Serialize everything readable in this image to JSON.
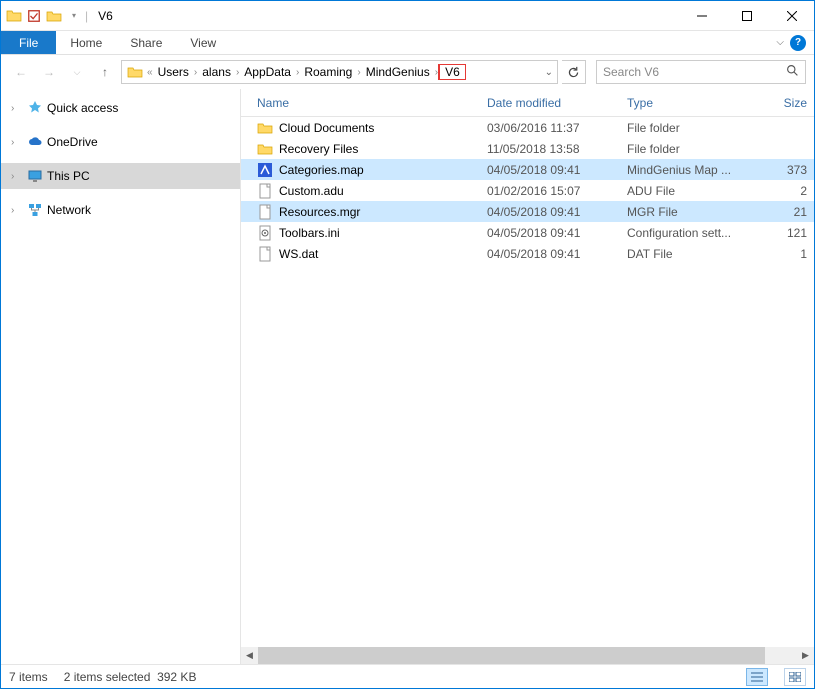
{
  "title": "V6",
  "ribbon": {
    "file": "File",
    "home": "Home",
    "share": "Share",
    "view": "View"
  },
  "breadcrumbs": [
    "Users",
    "alans",
    "AppData",
    "Roaming",
    "MindGenius",
    "V6"
  ],
  "breadcrumb_highlight_index": 5,
  "search_placeholder": "Search V6",
  "sidebar": {
    "items": [
      {
        "label": "Quick access",
        "icon": "star"
      },
      {
        "label": "OneDrive",
        "icon": "cloud"
      },
      {
        "label": "This PC",
        "icon": "monitor",
        "selected": true
      },
      {
        "label": "Network",
        "icon": "network"
      }
    ]
  },
  "columns": {
    "name": "Name",
    "date": "Date modified",
    "type": "Type",
    "size": "Size"
  },
  "files": [
    {
      "name": "Cloud Documents",
      "date": "03/06/2016 11:37",
      "type": "File folder",
      "size": "",
      "icon": "folder",
      "selected": false
    },
    {
      "name": "Recovery Files",
      "date": "11/05/2018 13:58",
      "type": "File folder",
      "size": "",
      "icon": "folder",
      "selected": false
    },
    {
      "name": "Categories.map",
      "date": "04/05/2018 09:41",
      "type": "MindGenius Map ...",
      "size": "373",
      "icon": "map",
      "selected": true
    },
    {
      "name": "Custom.adu",
      "date": "01/02/2016 15:07",
      "type": "ADU File",
      "size": "2",
      "icon": "file",
      "selected": false
    },
    {
      "name": "Resources.mgr",
      "date": "04/05/2018 09:41",
      "type": "MGR File",
      "size": "21",
      "icon": "file",
      "selected": true
    },
    {
      "name": "Toolbars.ini",
      "date": "04/05/2018 09:41",
      "type": "Configuration sett...",
      "size": "121",
      "icon": "ini",
      "selected": false
    },
    {
      "name": "WS.dat",
      "date": "04/05/2018 09:41",
      "type": "DAT File",
      "size": "1",
      "icon": "file",
      "selected": false
    }
  ],
  "status": {
    "items": "7 items",
    "selected": "2 items selected",
    "size": "392 KB"
  }
}
